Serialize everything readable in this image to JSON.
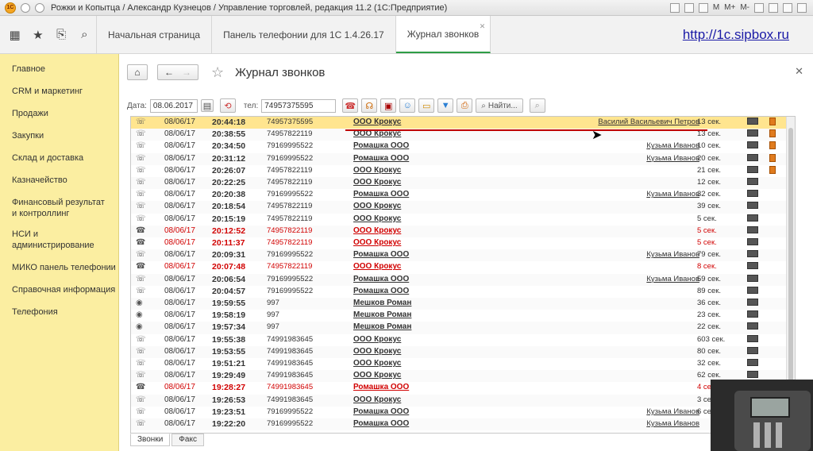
{
  "window": {
    "title": "Рожки и Копытца / Александр Кузнецов / Управление торговлей, редакция 11.2  (1С:Предприятие)",
    "right_labels": [
      "M",
      "M+",
      "M-"
    ]
  },
  "topnav": {
    "tabs": [
      {
        "label": "Начальная страница",
        "active": false
      },
      {
        "label": "Панель телефонии для 1С 1.4.26.17",
        "active": false
      },
      {
        "label": "Журнал звонков",
        "active": true
      }
    ],
    "link": "http://1c.sipbox.ru"
  },
  "sidebar": {
    "items": [
      {
        "label": "Главное"
      },
      {
        "label": "CRM и маркетинг"
      },
      {
        "label": "Продажи"
      },
      {
        "label": "Закупки"
      },
      {
        "label": "Склад и доставка"
      },
      {
        "label": "Казначейство"
      },
      {
        "label": "Финансовый результат и контроллинг"
      },
      {
        "label": "НСИ и администрирование"
      },
      {
        "label": "МИКО панель телефонии"
      },
      {
        "label": "Справочная информация"
      },
      {
        "label": "Телефония"
      }
    ]
  },
  "page": {
    "title": "Журнал звонков",
    "date_label": "Дата:",
    "date_value": "08.06.2017",
    "tel_label": "тел:",
    "tel_value": "74957375595",
    "find_label": "Найти..."
  },
  "rows": [
    {
      "date": "08/06/17",
      "time": "20:44:18",
      "num": "74957375595",
      "org": "ООО Крокус",
      "contact": "Василий Васильевич Петров",
      "dur": "13 сек.",
      "missed": false,
      "note": true,
      "selected": true,
      "icon": "phone"
    },
    {
      "date": "08/06/17",
      "time": "20:38:55",
      "num": "74957822119",
      "org": "ООО Крокус",
      "contact": "",
      "dur": "13 сек.",
      "missed": false,
      "note": true,
      "icon": "phone"
    },
    {
      "date": "08/06/17",
      "time": "20:34:50",
      "num": "79169995522",
      "org": "Ромашка ООО",
      "contact": "Кузьма Иванов",
      "dur": "10 сек.",
      "missed": false,
      "note": true,
      "icon": "phone"
    },
    {
      "date": "08/06/17",
      "time": "20:31:12",
      "num": "79169995522",
      "org": "Ромашка ООО",
      "contact": "Кузьма Иванов",
      "dur": "20 сек.",
      "missed": false,
      "note": true,
      "icon": "phone"
    },
    {
      "date": "08/06/17",
      "time": "20:26:07",
      "num": "74957822119",
      "org": "ООО Крокус",
      "contact": "",
      "dur": "21 сек.",
      "missed": false,
      "note": true,
      "icon": "phone"
    },
    {
      "date": "08/06/17",
      "time": "20:22:25",
      "num": "74957822119",
      "org": "ООО Крокус",
      "contact": "",
      "dur": "12 сек.",
      "missed": false,
      "note": false,
      "icon": "phone"
    },
    {
      "date": "08/06/17",
      "time": "20:20:38",
      "num": "79169995522",
      "org": "Ромашка ООО",
      "contact": "Кузьма Иванов",
      "dur": "32 сек.",
      "missed": false,
      "note": false,
      "icon": "phone"
    },
    {
      "date": "08/06/17",
      "time": "20:18:54",
      "num": "74957822119",
      "org": "ООО Крокус",
      "contact": "",
      "dur": "39 сек.",
      "missed": false,
      "note": false,
      "icon": "phone"
    },
    {
      "date": "08/06/17",
      "time": "20:15:19",
      "num": "74957822119",
      "org": "ООО Крокус",
      "contact": "",
      "dur": "5 сек.",
      "missed": false,
      "note": false,
      "icon": "phone"
    },
    {
      "date": "08/06/17",
      "time": "20:12:52",
      "num": "74957822119",
      "org": "ООО Крокус",
      "contact": "",
      "dur": "5 сек.",
      "missed": true,
      "note": false,
      "icon": "phone-missed"
    },
    {
      "date": "08/06/17",
      "time": "20:11:37",
      "num": "74957822119",
      "org": "ООО Крокус",
      "contact": "",
      "dur": "5 сек.",
      "missed": true,
      "note": false,
      "icon": "phone-missed"
    },
    {
      "date": "08/06/17",
      "time": "20:09:31",
      "num": "79169995522",
      "org": "Ромашка ООО",
      "contact": "Кузьма Иванов",
      "dur": "79 сек.",
      "missed": false,
      "note": false,
      "icon": "phone"
    },
    {
      "date": "08/06/17",
      "time": "20:07:48",
      "num": "74957822119",
      "org": "ООО Крокус",
      "contact": "",
      "dur": "8 сек.",
      "missed": true,
      "note": false,
      "icon": "phone-missed"
    },
    {
      "date": "08/06/17",
      "time": "20:06:54",
      "num": "79169995522",
      "org": "Ромашка ООО",
      "contact": "Кузьма Иванов",
      "dur": "59 сек.",
      "missed": false,
      "note": false,
      "icon": "phone"
    },
    {
      "date": "08/06/17",
      "time": "20:04:57",
      "num": "79169995522",
      "org": "Ромашка ООО",
      "contact": "",
      "dur": "89 сек.",
      "missed": false,
      "note": false,
      "icon": "phone"
    },
    {
      "date": "08/06/17",
      "time": "19:59:55",
      "num": "997",
      "org": "Мешков Роман",
      "contact": "",
      "dur": "36 сек.",
      "missed": false,
      "note": false,
      "icon": "eye"
    },
    {
      "date": "08/06/17",
      "time": "19:58:19",
      "num": "997",
      "org": "Мешков Роман",
      "contact": "",
      "dur": "23 сек.",
      "missed": false,
      "note": false,
      "icon": "eye"
    },
    {
      "date": "08/06/17",
      "time": "19:57:34",
      "num": "997",
      "org": "Мешков Роман",
      "contact": "",
      "dur": "22 сек.",
      "missed": false,
      "note": false,
      "icon": "eye"
    },
    {
      "date": "08/06/17",
      "time": "19:55:38",
      "num": "74991983645",
      "org": "ООО Крокус",
      "contact": "",
      "dur": "603 сек.",
      "missed": false,
      "note": false,
      "icon": "phone"
    },
    {
      "date": "08/06/17",
      "time": "19:53:55",
      "num": "74991983645",
      "org": "ООО Крокус",
      "contact": "",
      "dur": "80 сек.",
      "missed": false,
      "note": false,
      "icon": "phone"
    },
    {
      "date": "08/06/17",
      "time": "19:51:21",
      "num": "74991983645",
      "org": "ООО Крокус",
      "contact": "",
      "dur": "32 сек.",
      "missed": false,
      "note": false,
      "icon": "phone"
    },
    {
      "date": "08/06/17",
      "time": "19:29:49",
      "num": "74991983645",
      "org": "ООО Крокус",
      "contact": "",
      "dur": "62 сек.",
      "missed": false,
      "note": false,
      "icon": "phone"
    },
    {
      "date": "08/06/17",
      "time": "19:28:27",
      "num": "74991983645",
      "org": "Ромашка ООО",
      "contact": "",
      "dur": "4 сек.",
      "missed": true,
      "note": false,
      "icon": "phone-missed"
    },
    {
      "date": "08/06/17",
      "time": "19:26:53",
      "num": "74991983645",
      "org": "ООО Крокус",
      "contact": "",
      "dur": "3 сек.",
      "missed": false,
      "note": false,
      "icon": "phone"
    },
    {
      "date": "08/06/17",
      "time": "19:23:51",
      "num": "79169995522",
      "org": "Ромашка ООО",
      "contact": "Кузьма Иванов",
      "dur": "6 сек.",
      "missed": false,
      "note": false,
      "icon": "phone"
    },
    {
      "date": "08/06/17",
      "time": "19:22:20",
      "num": "79169995522",
      "org": "Ромашка ООО",
      "contact": "Кузьма Иванов",
      "dur": "",
      "missed": false,
      "note": false,
      "icon": "phone"
    }
  ],
  "bottom_tabs": [
    {
      "label": "Звонки",
      "active": true
    },
    {
      "label": "Факс",
      "active": false
    }
  ],
  "icons": {
    "phone": "☏",
    "phone-missed": "☎",
    "eye": "◉"
  },
  "colors": {
    "sidebar_bg": "#fbeea1",
    "selected_row": "#ffe58f",
    "missed_text": "#d10000",
    "active_tab_underline": "#2e9e46",
    "link": "#1a1aa6"
  }
}
